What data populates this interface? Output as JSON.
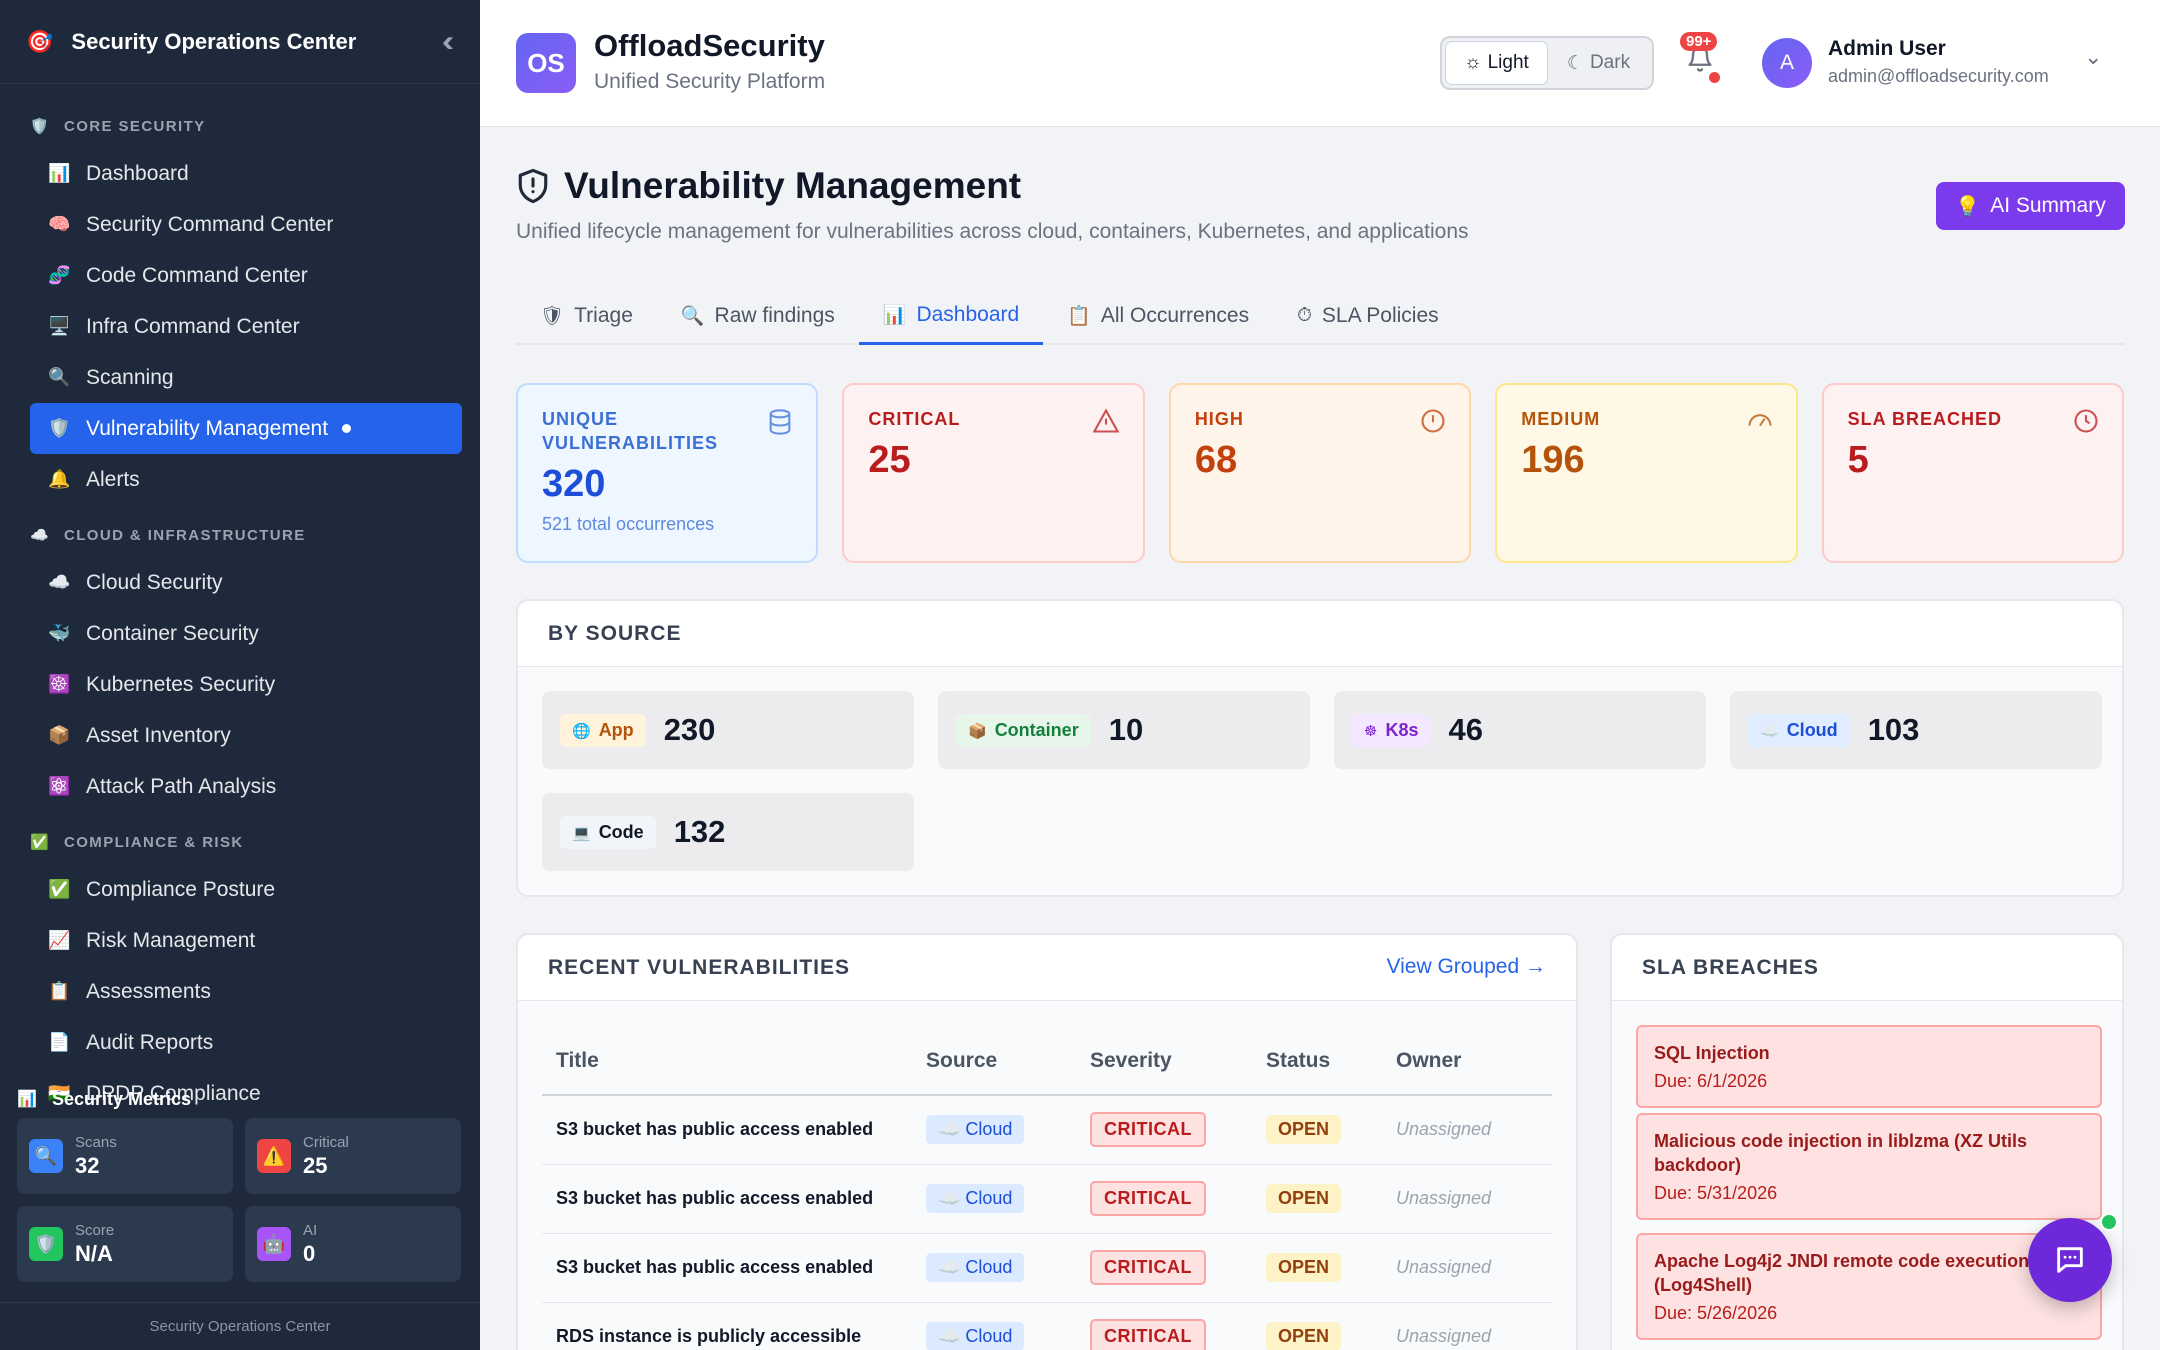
{
  "sidebar": {
    "title": "Security Operations Center",
    "logo_icon": "🎯",
    "sections": [
      {
        "label": "CORE SECURITY",
        "icon": "🛡️",
        "items": [
          {
            "label": "Dashboard",
            "icon": "📊"
          },
          {
            "label": "Security Command Center",
            "icon": "🧠"
          },
          {
            "label": "Code Command Center",
            "icon": "🧬"
          },
          {
            "label": "Infra Command Center",
            "icon": "🖥️"
          },
          {
            "label": "Scanning",
            "icon": "🔍"
          },
          {
            "label": "Vulnerability Management",
            "icon": "🛡️",
            "active": true
          },
          {
            "label": "Alerts",
            "icon": "🔔"
          }
        ]
      },
      {
        "label": "CLOUD & INFRASTRUCTURE",
        "icon": "☁️",
        "items": [
          {
            "label": "Cloud Security",
            "icon": "☁️"
          },
          {
            "label": "Container Security",
            "icon": "🐳"
          },
          {
            "label": "Kubernetes Security",
            "icon": "☸️"
          },
          {
            "label": "Asset Inventory",
            "icon": "📦"
          },
          {
            "label": "Attack Path Analysis",
            "icon": "⚛️"
          }
        ]
      },
      {
        "label": "COMPLIANCE & RISK",
        "icon": "✅",
        "items": [
          {
            "label": "Compliance Posture",
            "icon": "✅"
          },
          {
            "label": "Risk Management",
            "icon": "📈"
          },
          {
            "label": "Assessments",
            "icon": "📋"
          },
          {
            "label": "Audit Reports",
            "icon": "📄"
          },
          {
            "label": "DPDP Compliance",
            "icon": "🇮🇳"
          }
        ]
      }
    ],
    "metrics": {
      "title": "Security Metrics",
      "icon": "📊",
      "cards": [
        {
          "label": "Scans",
          "value": "32",
          "icon": "🔍",
          "color": "#3b82f6"
        },
        {
          "label": "Critical",
          "value": "25",
          "icon": "⚠️",
          "color": "#ef4444"
        },
        {
          "label": "Score",
          "value": "N/A",
          "icon": "🛡️",
          "color": "#22c55e"
        },
        {
          "label": "AI",
          "value": "0",
          "icon": "🤖",
          "color": "#a855f7"
        }
      ]
    },
    "footer": "Security Operations Center"
  },
  "topbar": {
    "logo_text": "OS",
    "brand": "OffloadSecurity",
    "subtitle": "Unified Security Platform",
    "theme_light": "Light",
    "theme_dark": "Dark",
    "notifications": "99+",
    "avatar_letter": "A",
    "user_name": "Admin User",
    "user_email": "admin@offloadsecurity.com"
  },
  "page": {
    "title": "Vulnerability Management",
    "subtitle": "Unified lifecycle management for vulnerabilities across cloud, containers, Kubernetes, and applications",
    "ai_button": "AI Summary",
    "tabs": [
      {
        "label": "Triage",
        "icon": "🛡"
      },
      {
        "label": "Raw findings",
        "icon": "🔍"
      },
      {
        "label": "Dashboard",
        "icon": "📊",
        "active": true
      },
      {
        "label": "All Occurrences",
        "icon": "📋"
      },
      {
        "label": "SLA Policies",
        "icon": "⏱"
      }
    ],
    "stats": [
      {
        "label": "UNIQUE VULNERABILITIES",
        "value": "320",
        "note": "521 total occurrences",
        "icon": "database-icon",
        "bg": "#eef6ff",
        "border": "#bfdbfe",
        "fg": "#1d4ed8",
        "labelColor": "#3b6fd6"
      },
      {
        "label": "CRITICAL",
        "value": "25",
        "note": "",
        "icon": "warning-icon",
        "bg": "#fef1f1",
        "border": "#fecaca",
        "fg": "#b91c1c",
        "labelColor": "#b91c1c"
      },
      {
        "label": "HIGH",
        "value": "68",
        "note": "",
        "icon": "alert-circle-icon",
        "bg": "#fff4ea",
        "border": "#fed7aa",
        "fg": "#c2410c",
        "labelColor": "#c2410c"
      },
      {
        "label": "MEDIUM",
        "value": "196",
        "note": "",
        "icon": "gauge-icon",
        "bg": "#fff8e6",
        "border": "#fde68a",
        "fg": "#b45309",
        "labelColor": "#b45309"
      },
      {
        "label": "SLA BREACHED",
        "value": "5",
        "note": "",
        "icon": "clock-icon",
        "bg": "#fef1f1",
        "border": "#fecaca",
        "fg": "#b91c1c",
        "labelColor": "#b91c1c"
      }
    ],
    "by_source": {
      "title": "BY SOURCE",
      "items": [
        {
          "label": "App",
          "value": "230",
          "icon": "🌐",
          "bg": "#fff3dc",
          "fg": "#b45309"
        },
        {
          "label": "Container",
          "value": "10",
          "icon": "📦",
          "bg": "#e7f6ea",
          "fg": "#15803d"
        },
        {
          "label": "K8s",
          "value": "46",
          "icon": "☸",
          "bg": "#f3e8ff",
          "fg": "#7e22ce"
        },
        {
          "label": "Cloud",
          "value": "103",
          "icon": "☁️",
          "bg": "#e0ecff",
          "fg": "#1d4ed8"
        },
        {
          "label": "Code",
          "value": "132",
          "icon": "💻",
          "bg": "#f1f5f9",
          "fg": "#111827"
        }
      ]
    },
    "recent": {
      "title": "RECENT VULNERABILITIES",
      "link": "View Grouped →",
      "columns": [
        "Title",
        "Source",
        "Severity",
        "Status",
        "Owner"
      ],
      "rows": [
        {
          "title": "S3 bucket has public access enabled",
          "source": "☁️ Cloud",
          "severity": "CRITICAL",
          "status": "OPEN",
          "owner": "Unassigned"
        },
        {
          "title": "S3 bucket has public access enabled",
          "source": "☁️ Cloud",
          "severity": "CRITICAL",
          "status": "OPEN",
          "owner": "Unassigned"
        },
        {
          "title": "S3 bucket has public access enabled",
          "source": "☁️ Cloud",
          "severity": "CRITICAL",
          "status": "OPEN",
          "owner": "Unassigned"
        },
        {
          "title": "RDS instance is publicly accessible",
          "source": "☁️ Cloud",
          "severity": "CRITICAL",
          "status": "OPEN",
          "owner": "Unassigned"
        }
      ]
    },
    "sla": {
      "title": "SLA BREACHES",
      "items": [
        {
          "title": "SQL Injection",
          "due": "Due: 6/1/2026"
        },
        {
          "title": "Malicious code injection in liblzma (XZ Utils backdoor)",
          "due": "Due: 5/31/2026"
        },
        {
          "title": "Apache Log4j2 JNDI remote code execution (Log4Shell)",
          "due": "Due: 5/26/2026"
        }
      ]
    }
  }
}
